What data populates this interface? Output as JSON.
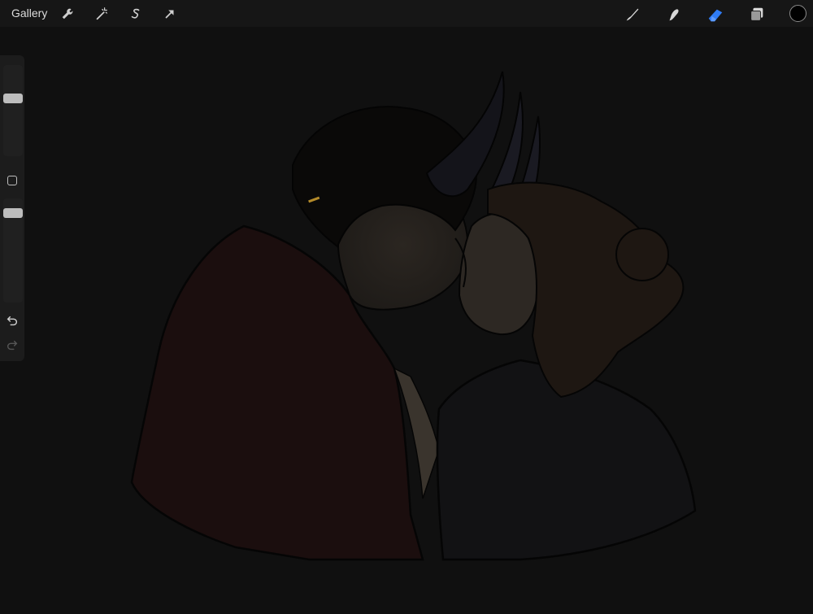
{
  "topbar": {
    "gallery_label": "Gallery",
    "left_tools": [
      "wrench-icon",
      "magic-wand-icon",
      "selection-s-icon",
      "transform-arrow-icon"
    ],
    "right_tools": [
      "brush-icon",
      "smudge-icon",
      "eraser-icon",
      "layers-icon"
    ],
    "active_tool": "eraser-icon",
    "accent_color": "#2f7cf6",
    "current_color": "#000000"
  },
  "sidebar": {
    "brush_size_level": 0.65,
    "opacity_level": 0.9,
    "undo_icon": "undo-icon",
    "redo_icon": "redo-icon"
  },
  "canvas": {
    "background": "#101010"
  }
}
